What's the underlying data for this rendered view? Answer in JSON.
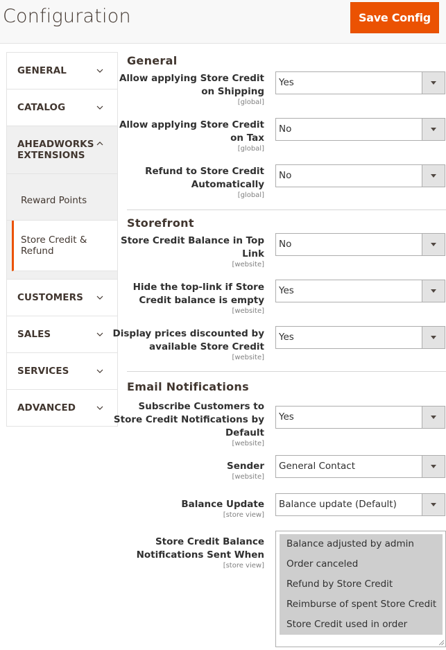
{
  "header": {
    "title": "Configuration",
    "save_label": "Save Config",
    "accent_color": "#eb5202"
  },
  "sidebar": {
    "groups": [
      {
        "label": "GENERAL",
        "icon": "chevron-down-icon",
        "expanded": false
      },
      {
        "label": "CATALOG",
        "icon": "chevron-down-icon",
        "expanded": false
      },
      {
        "label": "AHEADWORKS EXTENSIONS",
        "icon": "chevron-up-icon",
        "expanded": true,
        "items": [
          {
            "label": "Reward Points",
            "active": false
          },
          {
            "label": "Store Credit & Refund",
            "active": true
          }
        ]
      },
      {
        "label": "CUSTOMERS",
        "icon": "chevron-down-icon",
        "expanded": false
      },
      {
        "label": "SALES",
        "icon": "chevron-down-icon",
        "expanded": false
      },
      {
        "label": "SERVICES",
        "icon": "chevron-down-icon",
        "expanded": false
      },
      {
        "label": "ADVANCED",
        "icon": "chevron-down-icon",
        "expanded": false
      }
    ]
  },
  "sections": {
    "general": {
      "title": "General",
      "fields": [
        {
          "label_1": "Allow applying Store Credit",
          "label_2": "on Shipping",
          "scope": "[global]",
          "value": "Yes"
        },
        {
          "label_1": "Allow applying Store Credit",
          "label_2": "on Tax",
          "scope": "[global]",
          "value": "No"
        },
        {
          "label_1": "Refund to Store Credit",
          "label_2": "Automatically",
          "scope": "[global]",
          "value": "No"
        }
      ]
    },
    "storefront": {
      "title": "Storefront",
      "fields": [
        {
          "label_1": "Store Credit Balance in Top",
          "label_2": "Link",
          "scope": "[website]",
          "value": "No"
        },
        {
          "label_1": "Hide the top-link if Store",
          "label_2": "Credit balance is empty",
          "scope": "[website]",
          "value": "Yes"
        },
        {
          "label_1": "Display prices discounted by",
          "label_2": "available Store Credit",
          "scope": "[website]",
          "value": "Yes"
        }
      ]
    },
    "email": {
      "title": "Email Notifications",
      "fields": [
        {
          "label_1": "Subscribe Customers to",
          "label_2": "Store Credit Notifications by",
          "label_3": "Default",
          "scope": "[website]",
          "value": "Yes"
        },
        {
          "label_1": "Sender",
          "scope": "[website]",
          "value": "General Contact"
        },
        {
          "label_1": "Balance Update",
          "scope": "[store view]",
          "value": "Balance update (Default)"
        },
        {
          "label_1": "Store Credit Balance",
          "label_2": "Notifications Sent When",
          "scope": "[store view]",
          "options": [
            "Balance adjusted by admin",
            "Order canceled",
            "Refund by Store Credit",
            "Reimburse of spent Store Credit",
            "Store Credit used in order"
          ],
          "selected": [
            "Balance adjusted by admin",
            "Order canceled",
            "Refund by Store Credit",
            "Reimburse of spent Store Credit",
            "Store Credit used in order"
          ]
        }
      ]
    }
  }
}
